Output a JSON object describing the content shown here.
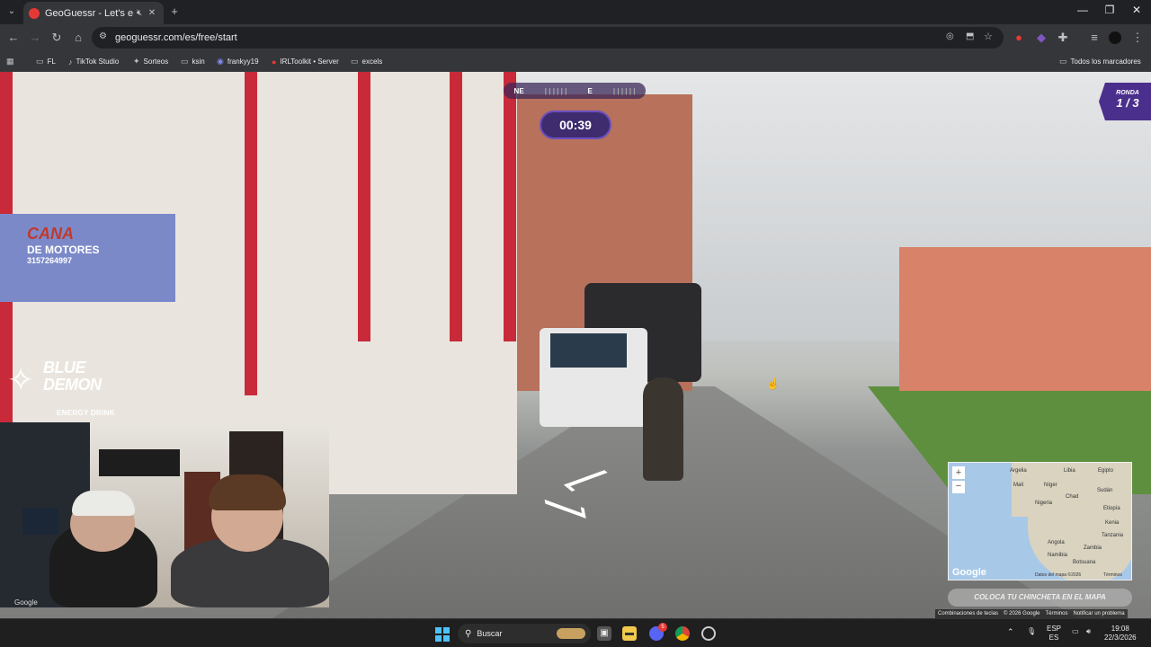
{
  "browser": {
    "tab_title": "GeoGuessr - Let's explore th",
    "url": "geoguessr.com/es/free/start",
    "bookmarks": [
      {
        "label": "FL",
        "icon": "folder-icon"
      },
      {
        "label": "TikTok Studio",
        "icon": "tiktok-icon"
      },
      {
        "label": "Sorteos",
        "icon": "star-icon"
      },
      {
        "label": "ksin",
        "icon": "folder-icon"
      },
      {
        "label": "frankyy19",
        "icon": "twitch-icon"
      },
      {
        "label": "IRLToolkit • Server",
        "icon": "server-icon"
      },
      {
        "label": "excels",
        "icon": "folder-icon"
      }
    ],
    "all_bookmarks": "Todos los marcadores"
  },
  "game": {
    "compass_labels": [
      "NE",
      "E"
    ],
    "timer": "00:39",
    "round_label": "RONDA",
    "round_value": "1 / 3",
    "place_pin_button": "COLOCA TU CHINCHETA EN EL MAPA",
    "google_label": "Google",
    "map_labels": {
      "spain": "España",
      "italy": "Italia",
      "algeria": "Argelia",
      "libya": "Libia",
      "egypt": "Egipto",
      "mali": "Malí",
      "niger": "Níger",
      "chad": "Chad",
      "sudan": "Sudán",
      "ethiopia": "Etiopía",
      "nigeria": "Nigeria",
      "kenya": "Kenia",
      "tanzania": "Tanzania",
      "angola": "Angola",
      "namibia": "Namibia",
      "botswana": "Botsuana",
      "zambia": "Zambia"
    },
    "map_data": "Datos del mapa ©2026",
    "map_terms": "Términos",
    "attribution": [
      "Combinaciones de teclas",
      "© 2026 Google",
      "Términos",
      "Notificar un problema"
    ]
  },
  "street": {
    "shop_sign_line1": "CANA",
    "shop_sign_line2": "DE MOTORES",
    "shop_phone": "3157264997"
  },
  "stream": {
    "brand_line1": "BLUE",
    "brand_line2": "DEMON",
    "tagline": "ENERGY DRINK",
    "google_watermark": "Google"
  },
  "taskbar": {
    "search_placeholder": "Buscar",
    "lang_line1": "ESP",
    "lang_line2": "ES",
    "time": "19:08",
    "date": "22/3/2026",
    "discord_badge": "5"
  }
}
